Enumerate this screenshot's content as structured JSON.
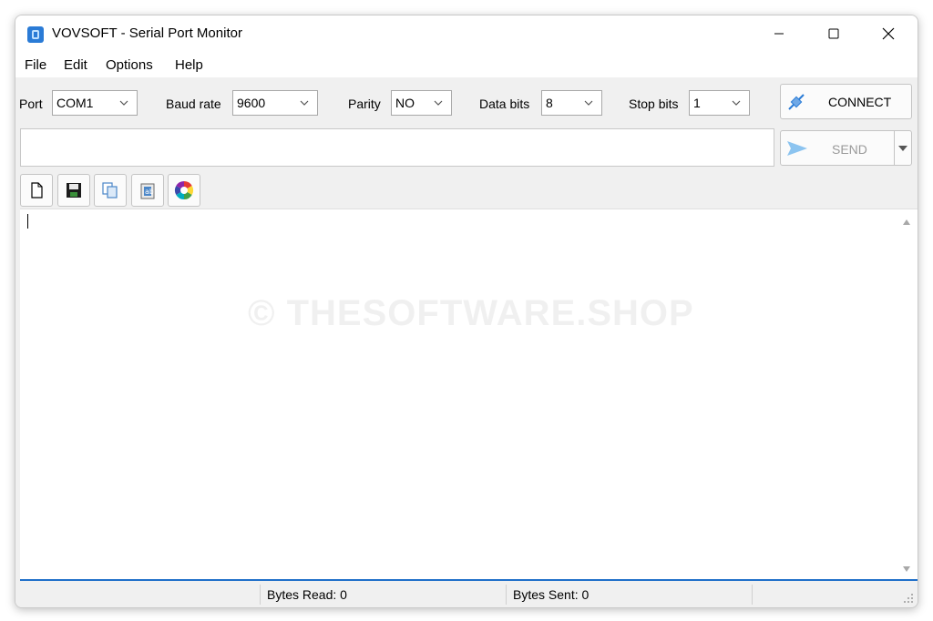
{
  "window": {
    "title": "VOVSOFT - Serial Port Monitor"
  },
  "menu": {
    "items": [
      "File",
      "Edit",
      "Options",
      "Help"
    ]
  },
  "settings": {
    "port_label": "Port",
    "port_value": "COM1",
    "baud_label": "Baud rate",
    "baud_value": "9600",
    "parity_label": "Parity",
    "parity_value": "NO",
    "databits_label": "Data bits",
    "databits_value": "8",
    "stopbits_label": "Stop bits",
    "stopbits_value": "1"
  },
  "buttons": {
    "connect": "CONNECT",
    "send": "SEND"
  },
  "watermark": "© THESOFTWARE.SHOP",
  "status": {
    "bytes_read": "Bytes Read: 0",
    "bytes_sent": "Bytes Sent: 0"
  },
  "icons": [
    "app-icon",
    "minimize-icon",
    "maximize-icon",
    "close-icon",
    "plug-icon",
    "send-arrow-icon",
    "new-document-icon",
    "save-icon",
    "copy-icon",
    "paste-icon",
    "color-palette-icon"
  ],
  "colors": {
    "accent": "#1f6fc9",
    "connect_icon": "#2a7bd6"
  }
}
